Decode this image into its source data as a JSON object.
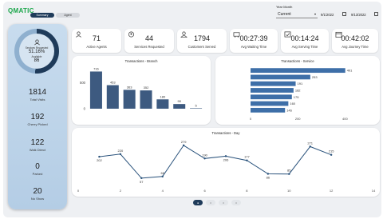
{
  "app": {
    "logo": "QMATIC"
  },
  "tabs": [
    {
      "label": "Summary",
      "active": true
    },
    {
      "label": "Agent",
      "active": false
    }
  ],
  "filters": {
    "year_month_label": "Year Month",
    "period_value": "Current",
    "date_from": "9/1/2022",
    "date_to": "9/13/2022"
  },
  "left_panel": {
    "gauge": {
      "label": "Services Requested",
      "percent": "51.16%",
      "percent_value": 51.16,
      "sub_label": "Available",
      "sub_value": "86"
    },
    "metrics": [
      {
        "value": "1814",
        "label": "Total Visits"
      },
      {
        "value": "192",
        "label": "Cherry Picked"
      },
      {
        "value": "122",
        "label": "Walk Direct"
      },
      {
        "value": "0",
        "label": "Parked"
      },
      {
        "value": "20",
        "label": "No Show"
      }
    ]
  },
  "kpis": [
    {
      "value": "71",
      "label": "Active Agents",
      "icon": "agents-icon"
    },
    {
      "value": "44",
      "label": "Services Requested",
      "icon": "services-icon"
    },
    {
      "value": "1794",
      "label": "Customers Served",
      "icon": "customers-icon"
    },
    {
      "value": "00:27:39",
      "label": "Avg Waiting Time",
      "icon": "waiting-icon"
    },
    {
      "value": "00:14:24",
      "label": "Avg Serving Time",
      "icon": "serving-icon"
    },
    {
      "value": "00:42:02",
      "label": "Avg Journey Time",
      "icon": "journey-icon"
    }
  ],
  "pager": [
    "●",
    "○",
    "○",
    "○"
  ],
  "colors": {
    "accent": "#1f3b5a",
    "bar": "#3d5a80",
    "hbar": "#3e6fa8",
    "line": "#27507a",
    "brand": "#1aa64a"
  },
  "chart_data": [
    {
      "type": "bar",
      "title": "Transactions - Branch",
      "categories": [
        "",
        "",
        "",
        "",
        "",
        "",
        ""
      ],
      "values": [
        716,
        453,
        363,
        352,
        180,
        90,
        5
      ],
      "ylim": [
        0,
        800
      ],
      "yticks": [
        0,
        500
      ],
      "grid": false
    },
    {
      "type": "bar",
      "orientation": "horizontal",
      "title": "Transactions - Service",
      "categories": [
        "",
        "",
        "",
        "",
        "",
        "",
        ""
      ],
      "values": [
        401,
        253,
        191,
        182,
        175,
        160,
        146
      ],
      "xlim": [
        0,
        500
      ],
      "xticks": [
        0,
        200,
        400
      ],
      "grid": false
    },
    {
      "type": "line",
      "title": "Transactions - Day",
      "x": [
        1,
        2,
        3,
        4,
        5,
        6,
        7,
        8,
        9,
        10,
        11,
        12,
        13
      ],
      "values": [
        202,
        220,
        57,
        68,
        279,
        190,
        206,
        177,
        86,
        85,
        271,
        215
      ],
      "x_points": [
        1,
        2,
        3,
        4,
        5,
        6,
        7,
        8,
        9,
        10,
        11,
        12
      ],
      "xticks": [
        0,
        2,
        4,
        6,
        8,
        10,
        12,
        14
      ],
      "grid": false
    }
  ]
}
